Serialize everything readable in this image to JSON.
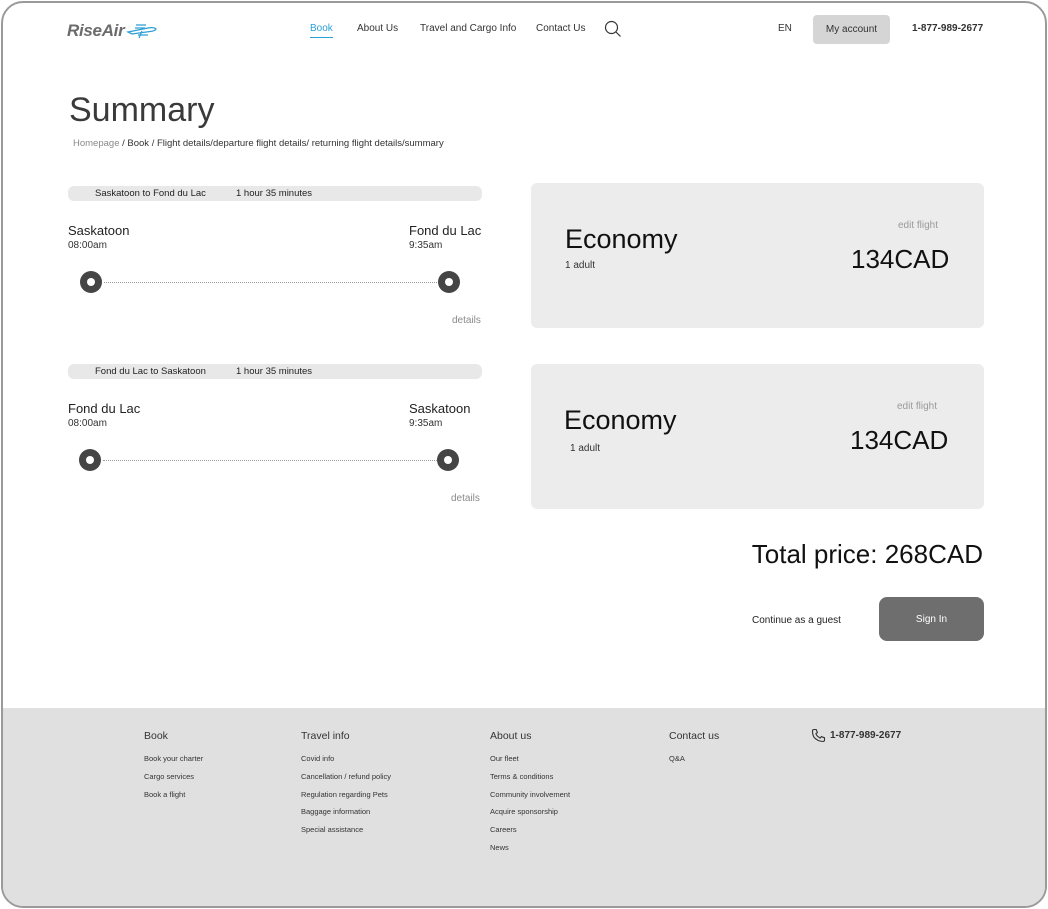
{
  "header": {
    "logo_text": "RiseAir",
    "nav": [
      {
        "label": "Book",
        "active": true
      },
      {
        "label": "About Us",
        "active": false
      },
      {
        "label": "Travel and Cargo Info",
        "active": false
      },
      {
        "label": "Contact Us",
        "active": false
      }
    ],
    "search_icon": "search-icon",
    "language": "EN",
    "account_label": "My account",
    "phone": "1-877-989-2677",
    "accent_color": "#2b9fd6"
  },
  "page": {
    "title": "Summary",
    "breadcrumb_home": "Homepage",
    "breadcrumb_rest": " / Book / Flight details/departure flight details/ returning flight details/summary"
  },
  "flights": [
    {
      "route": "Saskatoon to Fond du Lac",
      "duration": "1 hour 35 minutes",
      "from_city": "Saskatoon",
      "from_time": "08:00am",
      "to_city": "Fond du Lac",
      "to_time": "9:35am",
      "details_label": "details",
      "fare_class": "Economy",
      "passengers": "1 adult",
      "edit_label": "edit flight",
      "price": "134CAD"
    },
    {
      "route": "Fond du Lac to Saskatoon",
      "duration": "1 hour 35 minutes",
      "from_city": "Fond du Lac",
      "from_time": "08:00am",
      "to_city": "Saskatoon",
      "to_time": "9:35am",
      "details_label": "details",
      "fare_class": "Economy",
      "passengers": "1 adult",
      "edit_label": "edit flight",
      "price": "134CAD"
    }
  ],
  "checkout": {
    "total": "Total price: 268CAD",
    "guest_label": "Continue as a guest",
    "signin_label": "Sign In"
  },
  "footer": {
    "columns": [
      {
        "heading": "Book",
        "links": [
          "Book your charter",
          "Cargo services",
          "Book a flight"
        ]
      },
      {
        "heading": "Travel info",
        "links": [
          "Covid info",
          "Cancellation / refund policy",
          "Regulation regarding Pets",
          "Baggage information",
          "Special assistance"
        ]
      },
      {
        "heading": "About us",
        "links": [
          "Our fleet",
          "Terms & conditions",
          "Community involvement",
          "Acquire sponsorship",
          "Careers",
          "News"
        ]
      },
      {
        "heading": "Contact us",
        "links": [
          "Q&A"
        ]
      }
    ],
    "phone": "1-877-989-2677",
    "phone_icon": "phone-icon"
  }
}
